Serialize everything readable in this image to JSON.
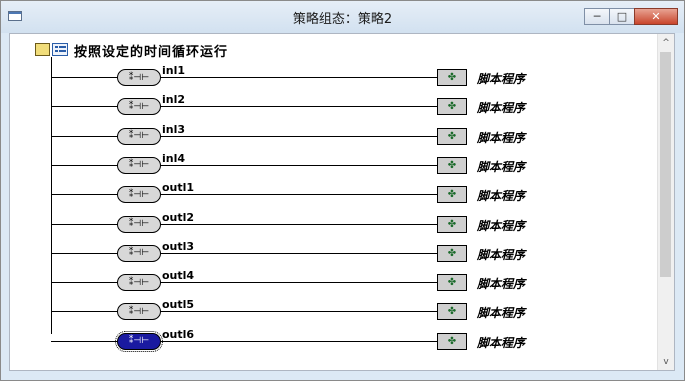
{
  "window": {
    "title": "策略组态：策略2",
    "minimize_glyph": "─",
    "maximize_glyph": "□",
    "close_glyph": "✕"
  },
  "scroll": {
    "up_glyph": "^",
    "down_glyph": "v"
  },
  "root": {
    "label": "按照设定的时间循环运行"
  },
  "rows": [
    {
      "condition": "inl1",
      "action": "脚本程序",
      "selected": false
    },
    {
      "condition": "inl2",
      "action": "脚本程序",
      "selected": false
    },
    {
      "condition": "inl3",
      "action": "脚本程序",
      "selected": false
    },
    {
      "condition": "inl4",
      "action": "脚本程序",
      "selected": false
    },
    {
      "condition": "outl1",
      "action": "脚本程序",
      "selected": false
    },
    {
      "condition": "outl2",
      "action": "脚本程序",
      "selected": false
    },
    {
      "condition": "outl3",
      "action": "脚本程序",
      "selected": false
    },
    {
      "condition": "outl4",
      "action": "脚本程序",
      "selected": false
    },
    {
      "condition": "outl5",
      "action": "脚本程序",
      "selected": false
    },
    {
      "condition": "outl6",
      "action": "脚本程序",
      "selected": true
    }
  ],
  "icons": {
    "condition_glyph": "⁑⊣⊢",
    "action_glyph": "✤"
  }
}
